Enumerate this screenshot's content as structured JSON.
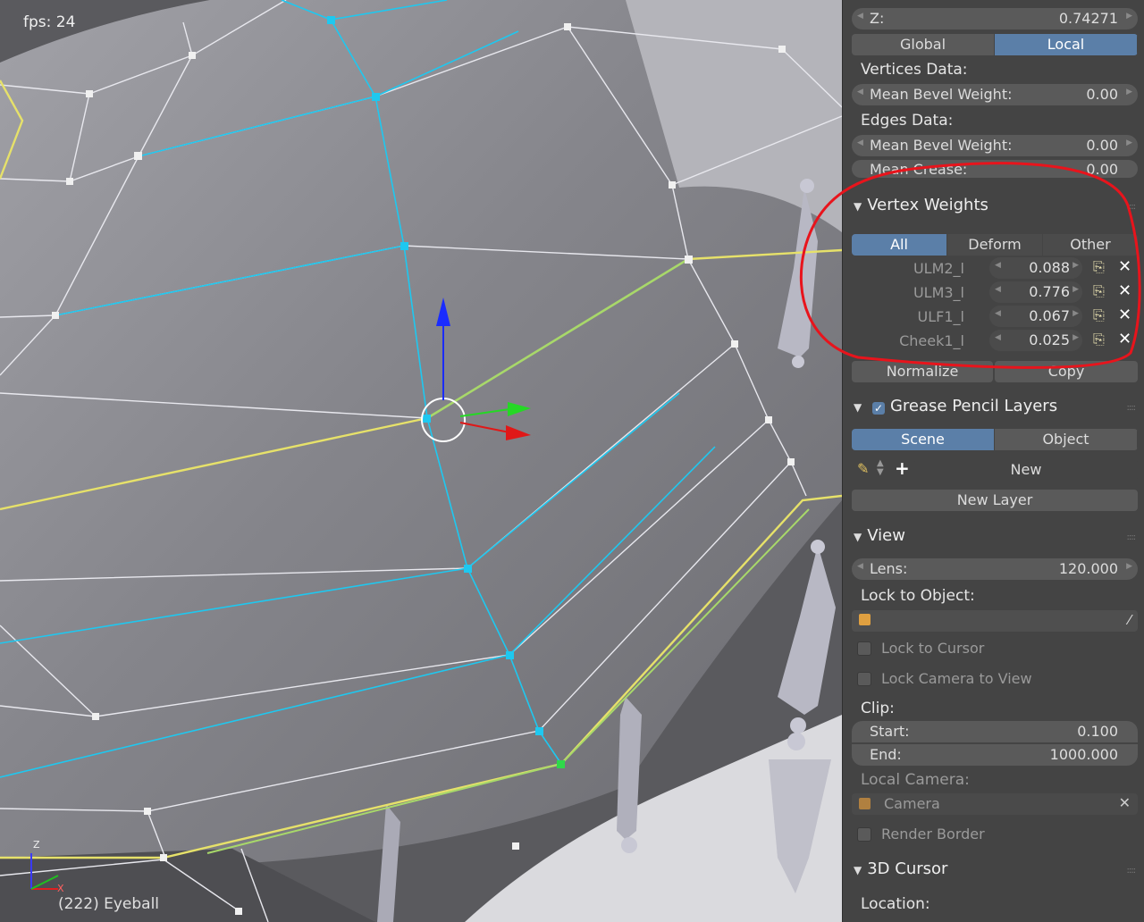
{
  "viewport": {
    "fps": "fps: 24",
    "object_label": "(222) Eyeball",
    "axis_z": "Z",
    "axis_x": "X"
  },
  "panel": {
    "transform": {
      "z_label": "Z:",
      "z_value": "0.74271",
      "global": "Global",
      "local": "Local",
      "active": "Local"
    },
    "vertices_data": {
      "title": "Vertices Data:",
      "mean_bevel_label": "Mean Bevel Weight:",
      "mean_bevel_value": "0.00"
    },
    "edges_data": {
      "title": "Edges Data:",
      "mean_bevel_label": "Mean Bevel Weight:",
      "mean_bevel_value": "0.00",
      "mean_crease_label": "Mean Crease:",
      "mean_crease_value": "0.00"
    },
    "vertex_weights": {
      "title": "Vertex Weights",
      "tabs": [
        "All",
        "Deform",
        "Other"
      ],
      "active_tab": "All",
      "rows": [
        {
          "name": "ULM2_l",
          "value": "0.088"
        },
        {
          "name": "ULM3_l",
          "value": "0.776"
        },
        {
          "name": "ULF1_l",
          "value": "0.067"
        },
        {
          "name": "Cheek1_l",
          "value": "0.025"
        }
      ],
      "normalize": "Normalize",
      "copy": "Copy"
    },
    "grease_pencil": {
      "title": "Grease Pencil Layers",
      "checked": true,
      "scene": "Scene",
      "object": "Object",
      "active": "Scene",
      "new": "New",
      "new_layer": "New Layer"
    },
    "view": {
      "title": "View",
      "lens_label": "Lens:",
      "lens_value": "120.000",
      "lock_to_object": "Lock to Object:",
      "lock_to_cursor": "Lock to Cursor",
      "lock_camera_to_view": "Lock Camera to View",
      "clip": "Clip:",
      "start_label": "Start:",
      "start_value": "0.100",
      "end_label": "End:",
      "end_value": "1000.000",
      "local_camera": "Local Camera:",
      "camera_value": "Camera",
      "render_border": "Render Border"
    },
    "cursor_3d": {
      "title": "3D Cursor",
      "location": "Location:"
    }
  },
  "colors": {
    "accent": "#5b7fa8",
    "annotation": "#e8141c",
    "selected_edge": "#1ec8f0",
    "seam": "#e6e16a"
  }
}
